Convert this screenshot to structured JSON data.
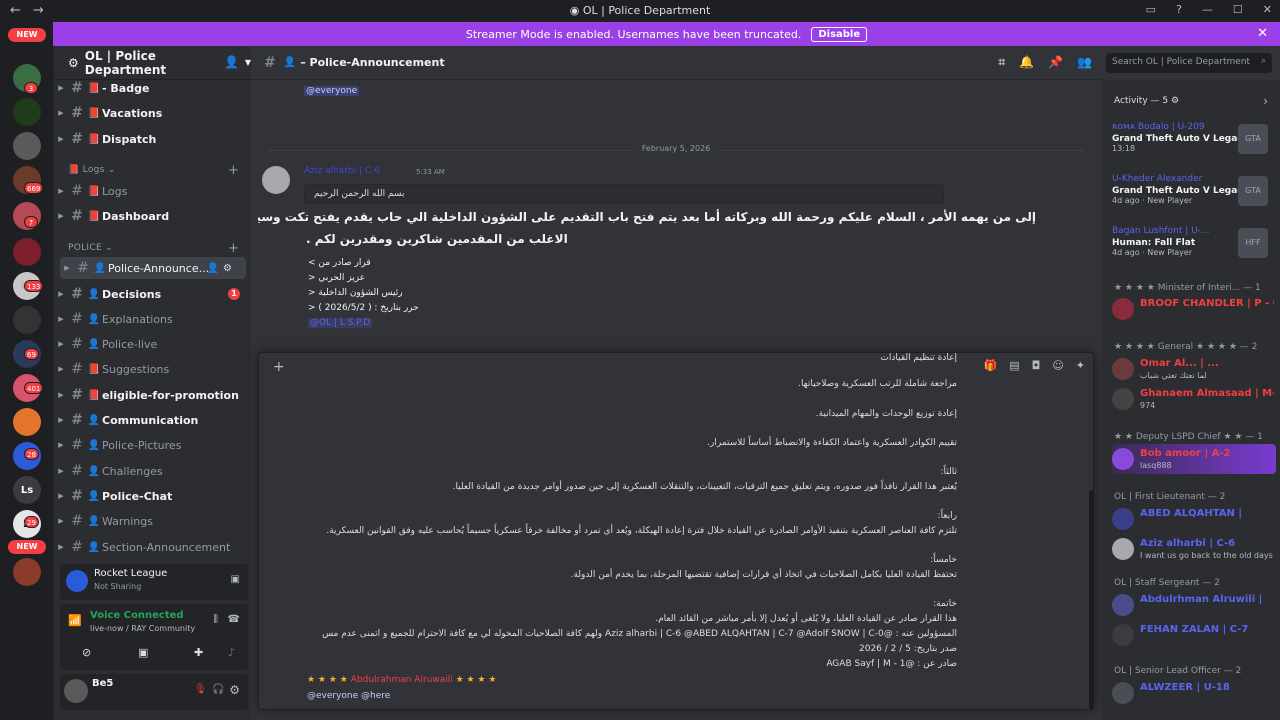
{
  "window": {
    "title": "OL | Police Department",
    "back_glyph": "←",
    "fwd_glyph": "→"
  },
  "banner": {
    "text": "Streamer Mode is enabled. Usernames have been truncated.",
    "button": "Disable"
  },
  "guilds": {
    "new_top": "NEW",
    "new_bottom": "NEW",
    "badges": [
      "3",
      "669",
      "7",
      "133",
      "69",
      "401",
      "28",
      "29"
    ],
    "ls_label": "Ls"
  },
  "server": {
    "name": "OL | Police Department"
  },
  "channels": {
    "c1": "- Badge",
    "c2": "Vacations",
    "c3": "Dispatch",
    "cat_logs": "Logs",
    "c4": "Logs",
    "c5": "Dashboard",
    "cat_police": "POLICE",
    "c6": "Police-Announce...",
    "c7": "Decisions",
    "c7_badge": "1",
    "c8": "Explanations",
    "c9": "Police-live",
    "c10": "Suggestions",
    "c11": "eligible-for-promotion",
    "c12": "Communication",
    "c13": "Police-Pictures",
    "c14": "Challenges",
    "c15": "Police-Chat",
    "c16": "Warnings",
    "c17": "Section-Announcement"
  },
  "activity_panel": {
    "game": "Rocket League",
    "status": "Not Sharing"
  },
  "voice": {
    "status": "Voice Connected",
    "channel": "live-now / RAY Community"
  },
  "user": {
    "name": "Be5"
  },
  "header": {
    "channel": "– Police-Announcement",
    "search_placeholder": "Search OL | Police Department"
  },
  "messages": {
    "everyone_top": "@everyone",
    "date": "February 5, 2026",
    "author": "Aziz alharbi | C-6",
    "time": "5:33 AM",
    "basmala": "بسم الله الرحمن الرحيم",
    "line1": "إلى من يهمه الأمر ، السلام عليكم ورحمة الله وبركاته أما بعد يتم فتح باب التقديم على الشؤون الداخلية الي حاب يقدم يفتح تكت وسيتم استقطاب",
    "line2": "الاغلب من المقدمين شاكرين ومقدرين لكم .",
    "dec1": "قرار صادر من >",
    "dec2": "عزيز الحربي <",
    "dec3": "رئيس الشؤون الداخلية <",
    "dec4": "حرر بتاريخ : ( 2026/5/2 ) <",
    "dec5": "@OL | L S.P.D"
  },
  "popout": {
    "lines": [
      "إعادة تنظيم القيادات",
      "مراجعة شاملة للرتب العسكرية وصلاحياتها.",
      "إعادة توزيع الوحدات والمهام الميدانية.",
      "تقييم الكوادر العسكرية واعتماد الكفاءة والانضباط أساساً للاستمرار.",
      "ثالثاً:",
      "يُعتبر هذا القرار نافذاً فور صدوره، ويتم تعليق جميع الترقيات، التعيينات، والتنقلات العسكرية إلى حين صدور أوامر جديدة من القيادة العليا.",
      "رابعاً:",
      "تلتزم كافة العناصر العسكرية بتنفيذ الأوامر الصادرة عن القيادة خلال فترة إعادة الهيكلة، ويُعد أي تمرد أو مخالفة خرقاً عسكرياً جسيماً يُحاسب عليه وفق القوانين العسكرية.",
      "خامساً:",
      "تحتفظ القيادة العليا بكامل الصلاحيات في اتخاذ أي قرارات إضافية تقتضيها المرحلة، بما يخدم أمن الدولة.",
      "خاتمة:",
      "هذا القرار صادر عن القيادة العليا، ولا يُلغى أو يُعدل إلا بأمر مباشر من القائد العام.",
      "المسؤولين عنه : @Aziz alharbi | C-6 @ABED ALQAHTAN | C-7 @Adolf SNOW | C-0 ولهم كافة الصلاحيات المخوله لي مع كافة الاحترام للجميع و اتمنى عدم مس",
      "صدر بتاريخ: 5 / 2 / 2026",
      "صادر عن : @AGAB Sayf | M - 1"
    ],
    "footer_name": "Abdulrahman Alruwaili",
    "footer_mentions": "@everyone @here",
    "stars": "★ ★ ★ ★"
  },
  "members": {
    "activity_header": "Activity — 5",
    "acts": [
      {
        "name": "ʀᴏᴍᴀ Bodalo | U-209",
        "game": "Grand Theft Auto V Legacy",
        "meta": "13:18",
        "thumb": "GTA"
      },
      {
        "name": "U-Kheder Alexander",
        "game": "Grand Theft Auto V Legacy",
        "meta": "4d ago · New Player",
        "thumb": "GTA"
      },
      {
        "name": "Bagan Lushfont | U-...",
        "game": "Human: Fall Flat",
        "meta": "4d ago · New Player",
        "thumb": "HFF"
      }
    ],
    "groups": [
      {
        "title": "★ ★ ★ ★ Minister of Interi... — 1",
        "rows": [
          {
            "name": "BROOF CHANDLER | P - 0",
            "sub": "",
            "color": "#f23f43"
          }
        ]
      },
      {
        "title": "★ ★ ★ ★ General ★ ★ ★ ★ — 2",
        "rows": [
          {
            "name": "Omar Al... | ...",
            "sub": "لما تعتك تعتي شباب",
            "color": "#f23f43"
          },
          {
            "name": "Ghanaem Almasaad | M-2",
            "sub": "974",
            "color": "#f23f43"
          }
        ]
      },
      {
        "title": "★ ★ Deputy LSPD Chief ★ ★ — 1",
        "rows": [
          {
            "name": "Bob amoor | A-2",
            "sub": "lasq888",
            "color": "#f23f43"
          }
        ]
      },
      {
        "title": "OL | First Lieutenant — 2",
        "rows": [
          {
            "name": "ABED ALQAHTAN |",
            "sub": "",
            "color": "#5865f2"
          },
          {
            "name": "Aziz alharbi | C-6",
            "sub": "I want us go back to the old days b...",
            "color": "#5865f2"
          }
        ]
      },
      {
        "title": "OL | Staff Sergeant — 2",
        "rows": [
          {
            "name": "Abdulrhman Alruwili |",
            "sub": "",
            "color": "#5865f2"
          },
          {
            "name": "FEHAN ZALAN | C-7",
            "sub": "",
            "color": "#5865f2"
          }
        ]
      },
      {
        "title": "OL | Senior Lead Officer — 2",
        "rows": [
          {
            "name": "ALWZEER | U-18",
            "sub": "",
            "color": "#5865f2"
          }
        ]
      }
    ]
  }
}
